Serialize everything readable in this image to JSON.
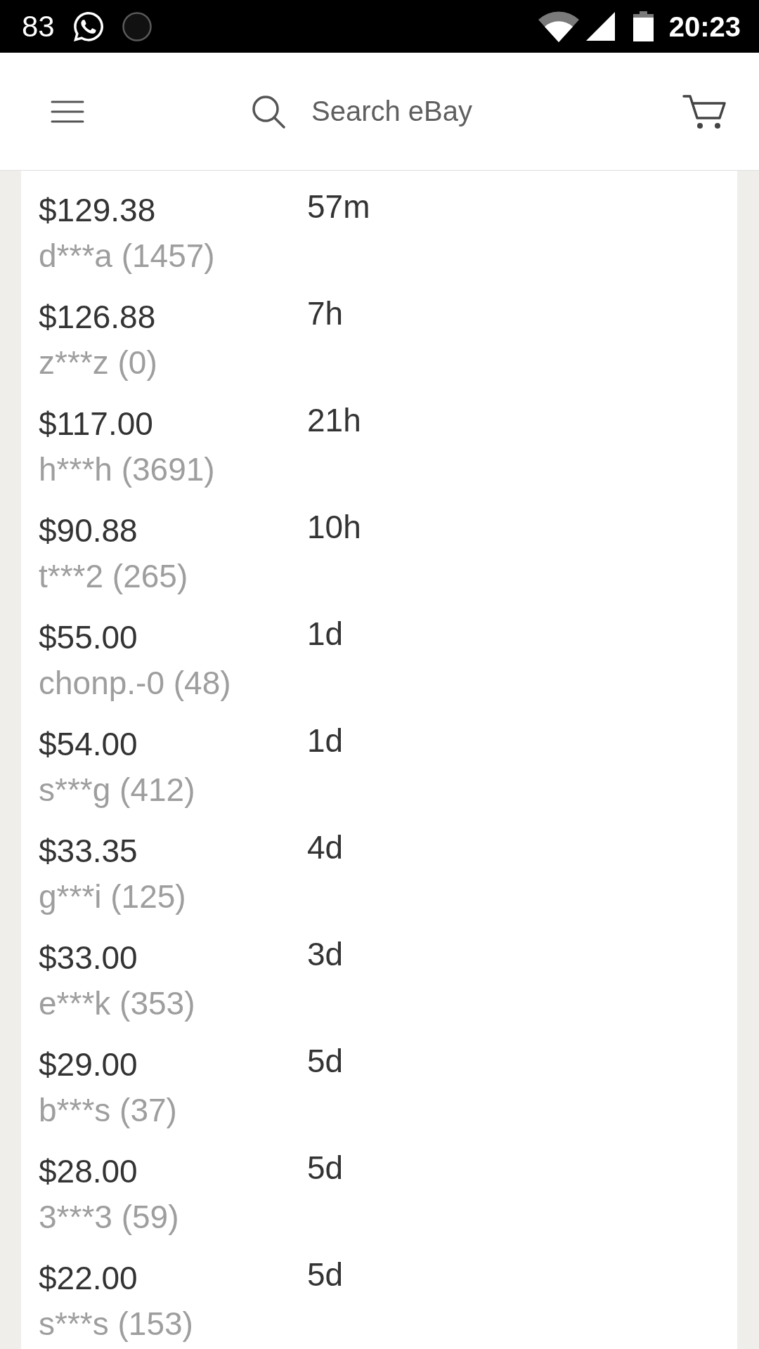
{
  "status_bar": {
    "notification_count": "83",
    "time": "20:23"
  },
  "header": {
    "search": {
      "placeholder": "Search eBay"
    }
  },
  "bids": [
    {
      "amount": "$129.38",
      "bidder": "d***a (1457)",
      "time": "57m"
    },
    {
      "amount": "$126.88",
      "bidder": "z***z (0)",
      "time": "7h"
    },
    {
      "amount": "$117.00",
      "bidder": "h***h (3691)",
      "time": "21h"
    },
    {
      "amount": "$90.88",
      "bidder": "t***2 (265)",
      "time": "10h"
    },
    {
      "amount": "$55.00",
      "bidder": "chonp.-0 (48)",
      "time": "1d"
    },
    {
      "amount": "$54.00",
      "bidder": "s***g (412)",
      "time": "1d"
    },
    {
      "amount": "$33.35",
      "bidder": "g***i (125)",
      "time": "4d"
    },
    {
      "amount": "$33.00",
      "bidder": "e***k (353)",
      "time": "3d"
    },
    {
      "amount": "$29.00",
      "bidder": "b***s (37)",
      "time": "5d"
    },
    {
      "amount": "$28.00",
      "bidder": "3***3 (59)",
      "time": "5d"
    },
    {
      "amount": "$22.00",
      "bidder": "s***s (153)",
      "time": "5d"
    }
  ]
}
